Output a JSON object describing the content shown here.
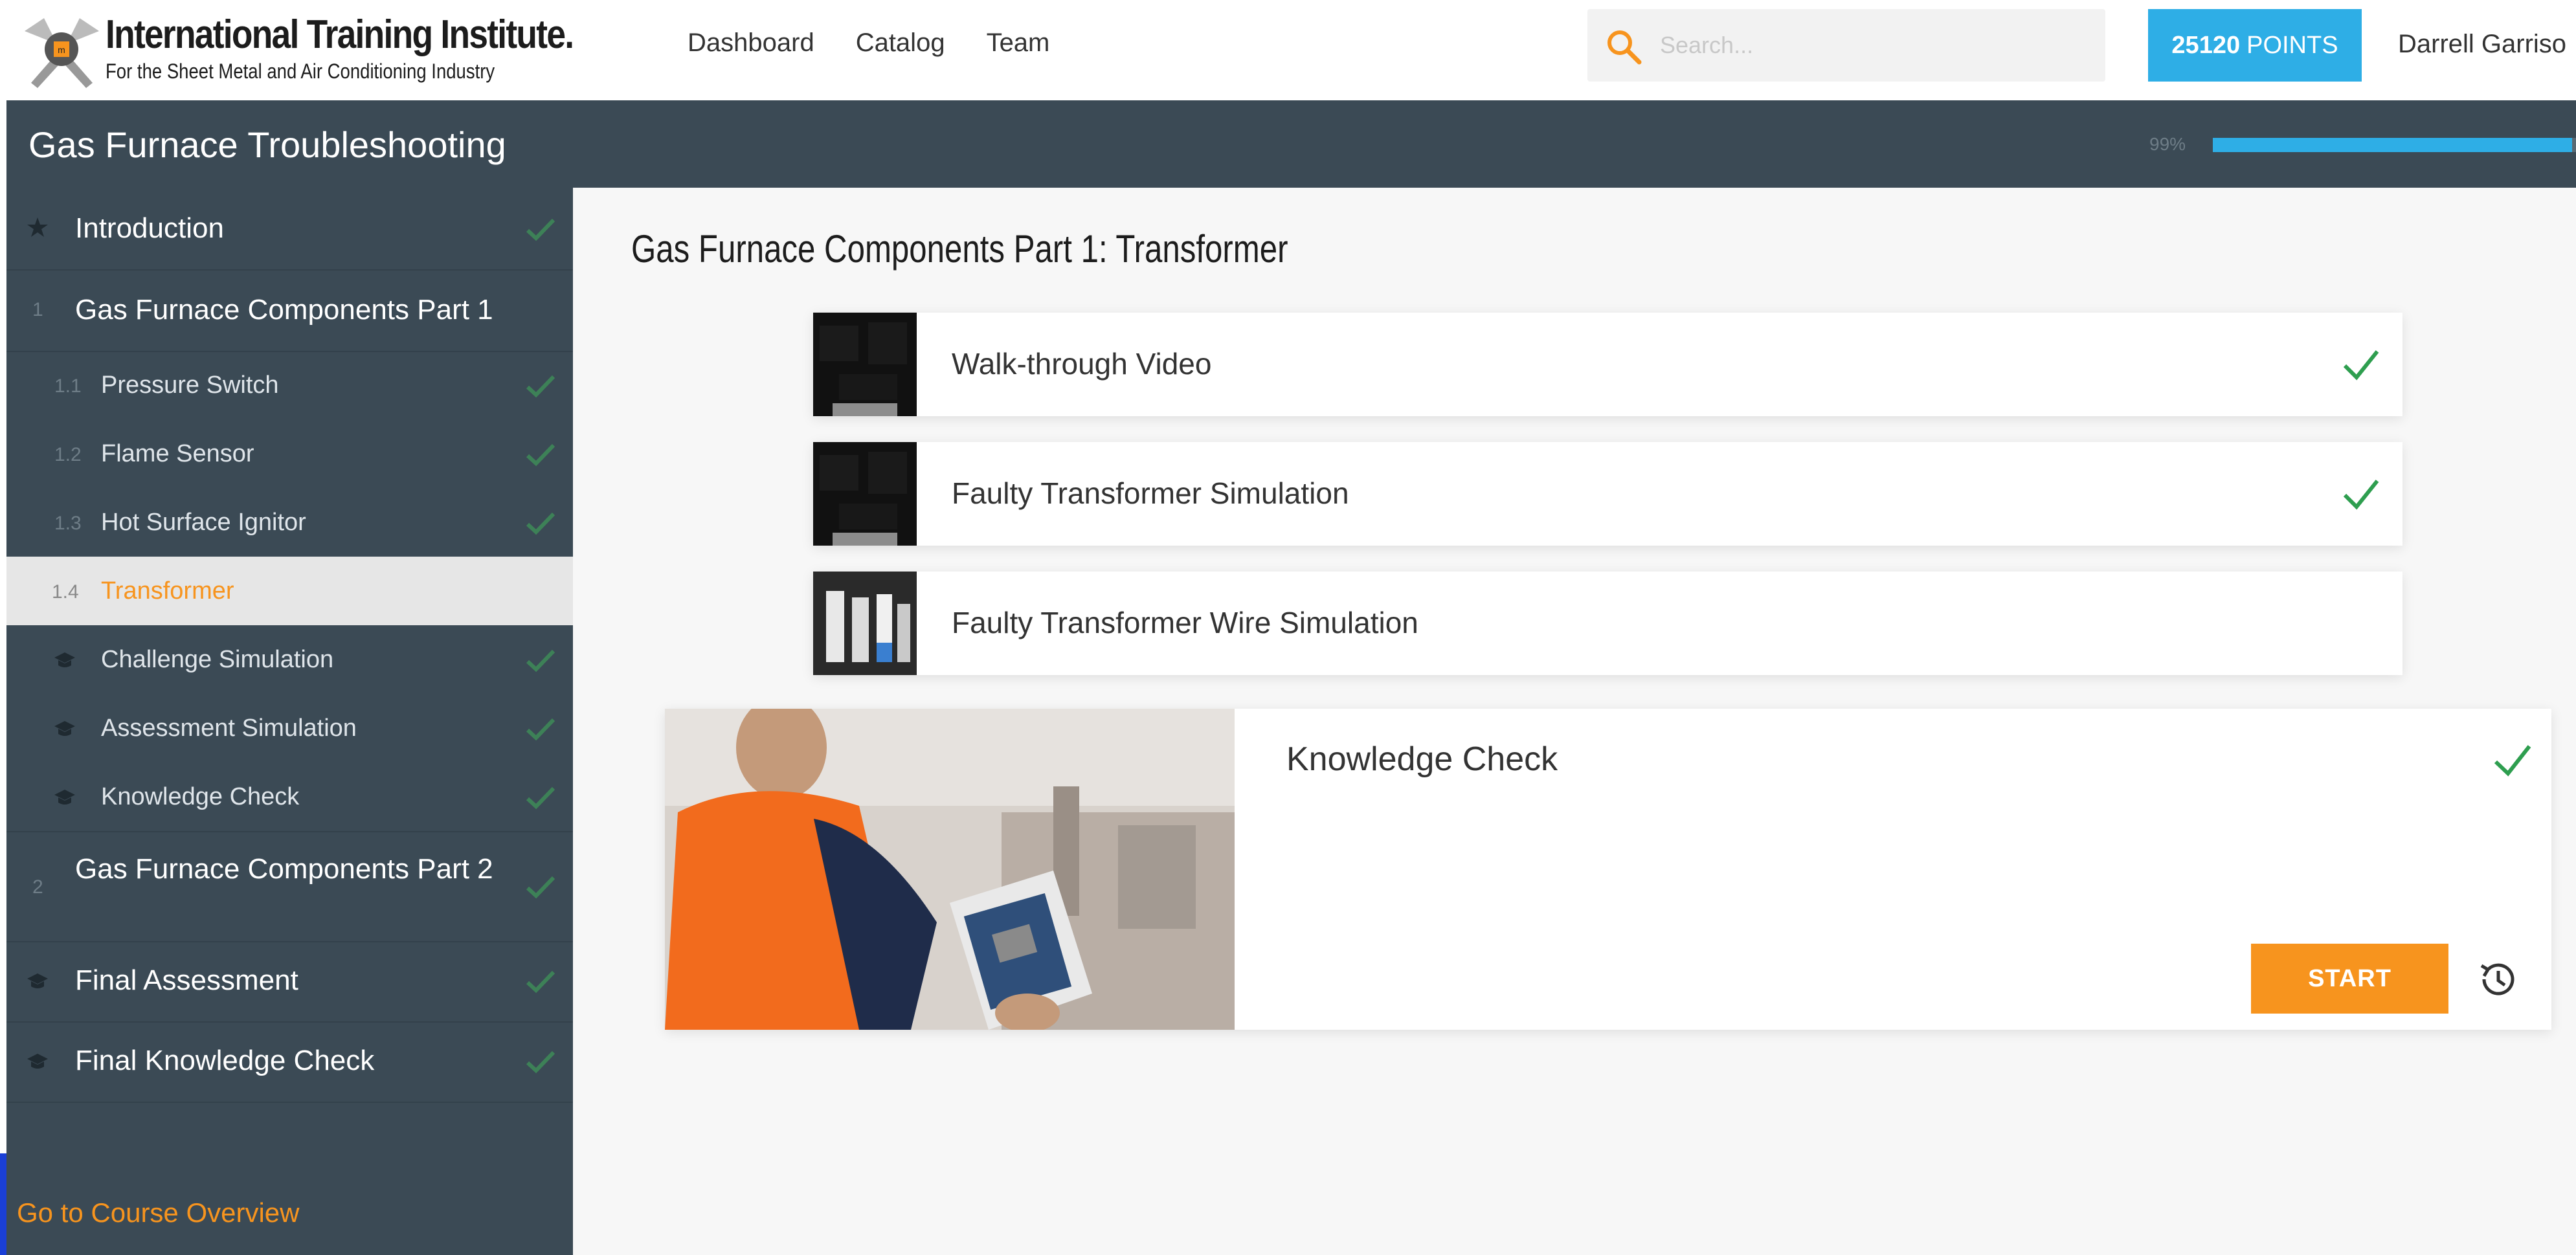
{
  "header": {
    "logo_title": "International Training Institute.",
    "logo_subtitle": "For the Sheet Metal and Air Conditioning Industry",
    "nav": [
      "Dashboard",
      "Catalog",
      "Team"
    ],
    "search_placeholder": "Search...",
    "points_value": "25120",
    "points_label": "POINTS",
    "user_name": "Darrell Garriso"
  },
  "course": {
    "title": "Gas Furnace Troubleshooting",
    "progress_label": "99%",
    "progress_fraction": 0.99
  },
  "sidebar": {
    "items": [
      {
        "label": "Introduction",
        "icon": "star-icon",
        "completed": true
      },
      {
        "label": "Gas Furnace Components Part 1",
        "number": "1",
        "completed": false
      },
      {
        "label": "Pressure Switch",
        "number": "1.1",
        "completed": true
      },
      {
        "label": "Flame Sensor",
        "number": "1.2",
        "completed": true
      },
      {
        "label": "Hot Surface Ignitor",
        "number": "1.3",
        "completed": true
      },
      {
        "label": "Transformer",
        "number": "1.4",
        "active": true
      },
      {
        "label": "Challenge Simulation",
        "icon": "graduation-cap-icon",
        "completed": true
      },
      {
        "label": "Assessment Simulation",
        "icon": "graduation-cap-icon",
        "completed": true
      },
      {
        "label": "Knowledge Check",
        "icon": "graduation-cap-icon",
        "completed": true
      },
      {
        "label": "Gas Furnace Components Part 2",
        "number": "2",
        "completed": true
      },
      {
        "label": "Final Assessment",
        "icon": "graduation-cap-icon",
        "completed": true
      },
      {
        "label": "Final Knowledge Check",
        "icon": "graduation-cap-icon",
        "completed": true
      }
    ],
    "go_to_overview": "Go to Course Overview"
  },
  "main": {
    "title": "Gas Furnace Components Part 1: Transformer",
    "lessons": [
      {
        "label": "Walk-through Video",
        "completed": true
      },
      {
        "label": "Faulty Transformer Simulation",
        "completed": true
      },
      {
        "label": "Faulty Transformer Wire Simulation",
        "completed": false
      }
    ],
    "knowledge_check": {
      "title": "Knowledge Check",
      "completed": true,
      "start_label": "START"
    }
  },
  "colors": {
    "accent_orange": "#f7941e",
    "accent_blue": "#2eaee6",
    "sidebar_bg": "#3b4a55",
    "check_green": "#2e9e4f"
  }
}
